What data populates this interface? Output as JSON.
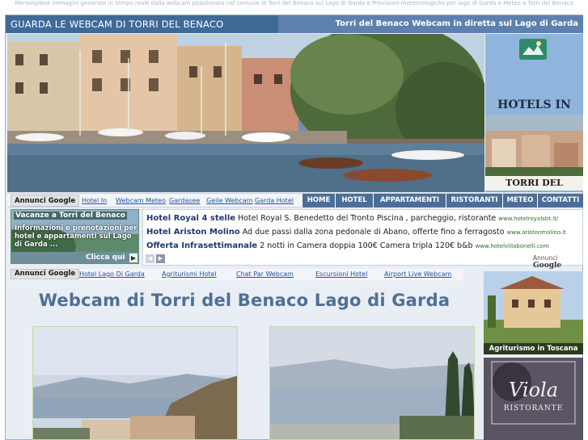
{
  "meta_text": "Meravigliose immagini generate in tempo reale dalla webcam posizionata nel comune di Torri del Benaco sul Lago di Garda e Previsioni meteorologiche per lago di Garda e Meteo a Torri del Benaco",
  "header": {
    "title_left": "GUARDA LE WEBCAM DI TORRI DEL BENACO",
    "title_right": "Torri del Benaco Webcam in diretta sul Lago di Garda"
  },
  "hotels_panel": {
    "title": "HOTELS IN",
    "subtitle": "TORRI DEL BENACO"
  },
  "nav": {
    "ads_label": "Annunci Google",
    "ad_links": [
      "Hotel In",
      "Webcam Meteo",
      "Gardasee",
      "Geile Webcam",
      "Garda Hotel"
    ],
    "menu": [
      "HOME",
      "HOTEL",
      "APPARTAMENTI",
      "RISTORANTI",
      "METEO",
      "CONTATTI"
    ]
  },
  "promo": {
    "title": "Vacanze a Torri del Benaco",
    "text": "Informazioni e prenotazioni per hotel e appartamenti sul Lago di Garda ...",
    "cta": "Clicca qui"
  },
  "ads": [
    {
      "title": "Hotel Royal 4 stelle",
      "text": "Hotel Royal S. Benedetto del Tronto Piscina , parcheggio, ristorante",
      "url": "www.hotelroyalsbt.it/"
    },
    {
      "title": "Hotel Ariston Molino",
      "text": "Ad due passi dalla zona pedonale di Abano, offerte fino a ferragosto",
      "url": "www.aristonmolino.it"
    },
    {
      "title": "Offerta Infrasettimanale",
      "text": "2 notti in Camera doppia 100€ Camera tripla 120€ b&b",
      "url": "www.hotelvillabonelli.com"
    }
  ],
  "ads_badge": {
    "label": "Annunci",
    "brand": "Google"
  },
  "nav2": {
    "ads_label": "Annunci Google",
    "links": [
      "Hotel Lago Di Garda",
      "Agriturismi Hotel",
      "Chat Par Webcam",
      "Escursioni Hotel",
      "Airport Live Webcam"
    ]
  },
  "main": {
    "heading": "Webcam di Torri del Benaco Lago di Garda"
  },
  "sidebar": {
    "agriturismo_caption": "Agriturismo in Toscana",
    "restaurant_name": "Viola",
    "restaurant_sub": "RISTORANTE"
  },
  "colors": {
    "header_dark": "#3f6a98",
    "header_light": "#5c81b0",
    "menu_button": "#4b6e99",
    "heading_text": "#4f6f96",
    "link": "#2750a0"
  }
}
